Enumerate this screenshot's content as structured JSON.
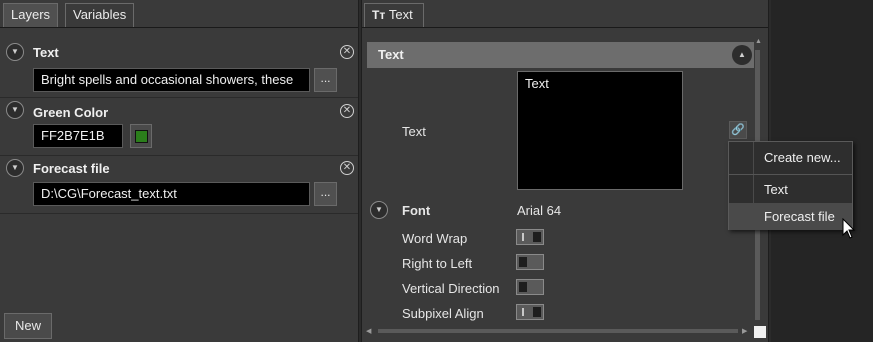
{
  "layers_panel": {
    "tabs": [
      "Layers",
      "Variables"
    ],
    "layers": [
      {
        "title": "Text",
        "value": "Bright spells and occasional showers, these",
        "has_browse": true,
        "browse_label": "..."
      },
      {
        "title": "Green Color",
        "value": "FF2B7E1B",
        "swatch_color": "#2b7e1b"
      },
      {
        "title": "Forecast file",
        "value": "D:\\CG\\Forecast_text.txt",
        "has_browse": true,
        "browse_label": "..."
      }
    ],
    "new_button": "New"
  },
  "text_panel": {
    "tab_label": "Text",
    "tab_icon": "text-type-icon",
    "section_title": "Text",
    "text_label": "Text",
    "text_value": "Text",
    "font_label": "Font",
    "font_value": "Arial 64",
    "toggles": [
      {
        "label": "Word Wrap",
        "on": true
      },
      {
        "label": "Right to Left",
        "on": false
      },
      {
        "label": "Vertical Direction",
        "on": false
      },
      {
        "label": "Subpixel Align",
        "on": true
      }
    ]
  },
  "link_menu": {
    "items": [
      "Create new...",
      "Text",
      "Forecast file"
    ],
    "hovered": "Forecast file"
  }
}
